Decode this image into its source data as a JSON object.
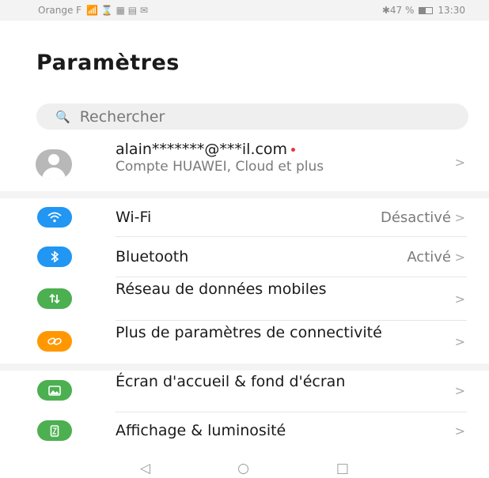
{
  "status_bar": {
    "carrier": "Orange F",
    "indicators": "📶 ⌛ ▦ ▤ ✉",
    "bluetooth_battery": "✱47 %",
    "time": "13:30"
  },
  "page_title": "Paramètres",
  "search": {
    "placeholder": "Rechercher",
    "icon": "search-icon"
  },
  "account": {
    "email": "alain*******@***il.com",
    "subtitle": "Compte HUAWEI, Cloud et plus",
    "chevron": ">"
  },
  "settings": [
    {
      "id": "wifi",
      "label": "Wi-Fi",
      "status": "Désactivé",
      "chevron": ">",
      "icon": "wifi-icon",
      "glyph": "📶",
      "color": "#2196f3"
    },
    {
      "id": "bluetooth",
      "label": "Bluetooth",
      "status": "Activé",
      "chevron": ">",
      "icon": "bluetooth-icon",
      "glyph": "✱",
      "color": "#2196f3"
    },
    {
      "id": "mobile-data",
      "label": "Réseau de données mobiles",
      "chevron": ">",
      "icon": "mobile-data-icon",
      "glyph": "1⇂",
      "color": "#4caf50"
    },
    {
      "id": "connectivity",
      "label": "Plus de paramètres de connectivité",
      "chevron": ">",
      "icon": "link-icon",
      "glyph": "🔗",
      "color": "#ff9800"
    },
    {
      "id": "home-screen",
      "label": "Écran d'accueil & fond d'écran",
      "chevron": ">",
      "icon": "wallpaper-icon",
      "glyph": "▣",
      "color": "#4caf50"
    },
    {
      "id": "display",
      "label": "Affichage & luminosité",
      "chevron": ">",
      "icon": "display-icon",
      "glyph": "◧",
      "color": "#4caf50"
    }
  ],
  "nav": {
    "back": "◁",
    "home": "○",
    "recents": "□"
  }
}
